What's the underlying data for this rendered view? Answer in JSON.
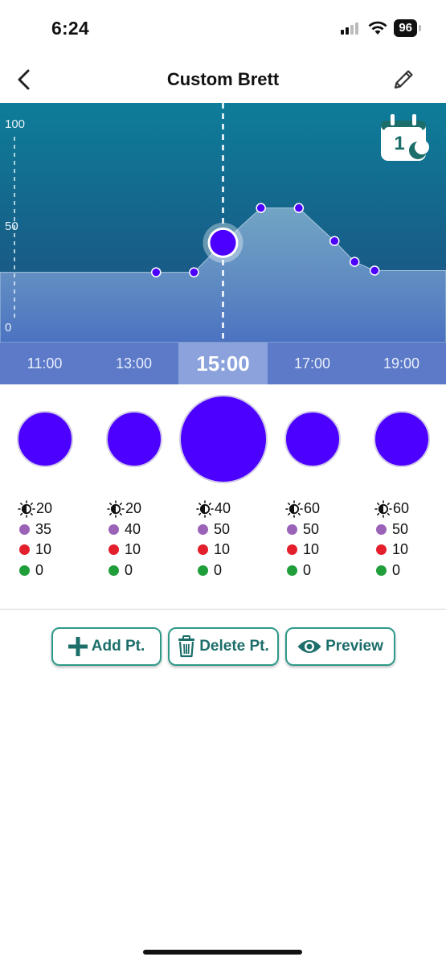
{
  "status": {
    "time": "6:24",
    "battery": "96"
  },
  "nav": {
    "title": "Custom Brett"
  },
  "chart_data": {
    "type": "area",
    "y_ticks": [
      "100",
      "50",
      "0"
    ],
    "ylim": [
      0,
      100
    ],
    "xlim": [
      10.0,
      20.0
    ],
    "points": [
      {
        "x": 13.5,
        "y": 15
      },
      {
        "x": 14.35,
        "y": 15
      },
      {
        "x": 15.0,
        "y": 32
      },
      {
        "x": 15.85,
        "y": 52
      },
      {
        "x": 16.7,
        "y": 52
      },
      {
        "x": 17.5,
        "y": 33
      },
      {
        "x": 17.95,
        "y": 21
      },
      {
        "x": 18.4,
        "y": 16
      }
    ],
    "selected_x": 15.0,
    "grid": false
  },
  "calendar": {
    "day": "1"
  },
  "time_strip": [
    "11:00",
    "13:00",
    "15:00",
    "17:00",
    "19:00"
  ],
  "points": [
    {
      "brightness": "20",
      "purple": "35",
      "red": "10",
      "green": "0",
      "selected": false
    },
    {
      "brightness": "20",
      "purple": "40",
      "red": "10",
      "green": "0",
      "selected": false
    },
    {
      "brightness": "40",
      "purple": "50",
      "red": "10",
      "green": "0",
      "selected": true
    },
    {
      "brightness": "60",
      "purple": "50",
      "red": "10",
      "green": "0",
      "selected": false
    },
    {
      "brightness": "60",
      "purple": "50",
      "red": "10",
      "green": "0",
      "selected": false
    }
  ],
  "colors": {
    "point": "#4c00ff",
    "purple_dot": "#9a63b8",
    "red_dot": "#e21f2a",
    "green_dot": "#1f9e3a",
    "accent": "#1c6e6a"
  },
  "actions": {
    "add": "Add Pt.",
    "delete": "Delete Pt.",
    "preview": "Preview"
  },
  "icons": {
    "back": "chevron-left-icon",
    "edit": "pencil-icon",
    "calendar": "calendar-moon-icon",
    "brightness": "brightness-icon",
    "add": "plus-icon",
    "delete": "trash-icon",
    "preview": "eye-icon"
  }
}
